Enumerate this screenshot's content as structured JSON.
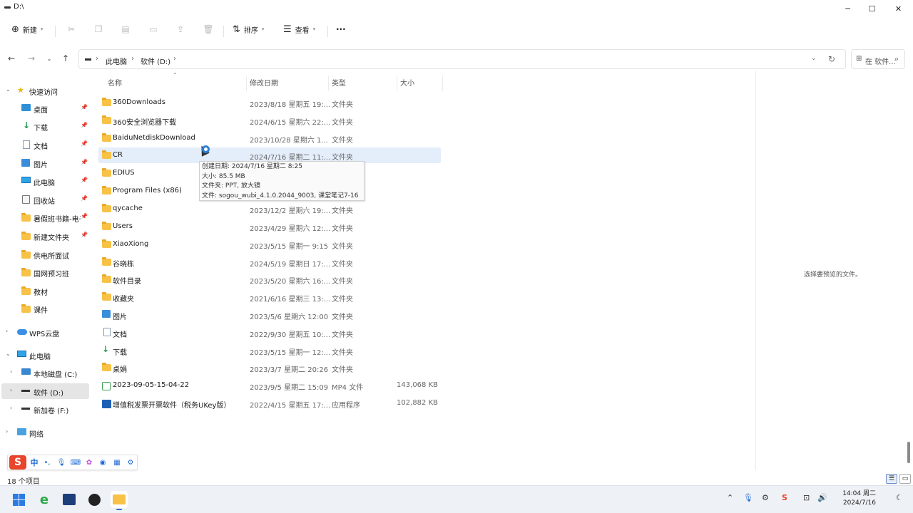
{
  "window": {
    "title": "D:\\",
    "controls": {
      "minimize": "─",
      "maximize": "☐",
      "close": "✕"
    }
  },
  "commandbar": {
    "new_label": "新建",
    "sort_label": "排序",
    "view_label": "查看",
    "more_label": "···"
  },
  "address": {
    "crumbs": [
      "此电脑",
      "软件 (D:)"
    ],
    "search_placeholder": "在 软件..."
  },
  "sidebar": {
    "items": [
      {
        "label": "快速访问"
      },
      {
        "label": "桌面"
      },
      {
        "label": "下载"
      },
      {
        "label": "文档"
      },
      {
        "label": "图片"
      },
      {
        "label": "此电脑"
      },
      {
        "label": "回收站"
      },
      {
        "label": "暑假班书籍-电子"
      },
      {
        "label": "新建文件夹"
      },
      {
        "label": "供电所面试"
      },
      {
        "label": "国网预习班"
      },
      {
        "label": "教材"
      },
      {
        "label": "课件"
      },
      {
        "label": "WPS云盘"
      },
      {
        "label": "此电脑"
      },
      {
        "label": "本地磁盘 (C:)"
      },
      {
        "label": "软件 (D:)"
      },
      {
        "label": "新加卷 (F:)"
      },
      {
        "label": "网络"
      }
    ]
  },
  "columns": {
    "name": "名称",
    "date": "修改日期",
    "type": "类型",
    "size": "大小"
  },
  "files": [
    {
      "name": "360Downloads",
      "date": "2023/8/18 星期五 19:...",
      "type": "文件夹",
      "size": ""
    },
    {
      "name": "360安全浏览器下载",
      "date": "2024/6/15 星期六 22:...",
      "type": "文件夹",
      "size": ""
    },
    {
      "name": "BaiduNetdiskDownload",
      "date": "2023/10/28 星期六 1...",
      "type": "文件夹",
      "size": ""
    },
    {
      "name": "CR",
      "date": "2024/7/16 星期二 11:...",
      "type": "文件夹",
      "size": ""
    },
    {
      "name": "EDIUS",
      "date": "",
      "type": "",
      "size": ""
    },
    {
      "name": "Program Files (x86)",
      "date": "",
      "type": "",
      "size": ""
    },
    {
      "name": "qycache",
      "date": "2023/12/2 星期六 19:...",
      "type": "文件夹",
      "size": ""
    },
    {
      "name": "Users",
      "date": "2023/4/29 星期六 12:...",
      "type": "文件夹",
      "size": ""
    },
    {
      "name": "XiaoXiong",
      "date": "2023/5/15 星期一 9:15",
      "type": "文件夹",
      "size": ""
    },
    {
      "name": "谷晓栋",
      "date": "2024/5/19 星期日 17:...",
      "type": "文件夹",
      "size": ""
    },
    {
      "name": "软件目录",
      "date": "2023/5/20 星期六 16:...",
      "type": "文件夹",
      "size": ""
    },
    {
      "name": "收藏夹",
      "date": "2021/6/16 星期三 13:...",
      "type": "文件夹",
      "size": ""
    },
    {
      "name": "图片",
      "date": "2023/5/6 星期六 12:00",
      "type": "文件夹",
      "size": ""
    },
    {
      "name": "文档",
      "date": "2022/9/30 星期五 10:...",
      "type": "文件夹",
      "size": ""
    },
    {
      "name": "下载",
      "date": "2023/5/15 星期一 12:...",
      "type": "文件夹",
      "size": ""
    },
    {
      "name": "桌娟",
      "date": "2023/3/7 星期二 20:26",
      "type": "文件夹",
      "size": ""
    },
    {
      "name": "2023-09-05-15-04-22",
      "date": "2023/9/5 星期二 15:09",
      "type": "MP4 文件",
      "size": "143,068 KB"
    },
    {
      "name": "增值税发票开票软件（税务UKey版）",
      "date": "2022/4/15 星期五 17:...",
      "type": "应用程序",
      "size": "102,882 KB"
    }
  ],
  "tooltip": {
    "line1": "创建日期: 2024/7/16 星期二 8:25",
    "line2": "大小: 85.5 MB",
    "line3": "文件夹: PPT, 放大镜",
    "line4": "文件: sogou_wubi_4.1.0.2044_9003, 课堂笔记7-16"
  },
  "preview_text": "选择要预览的文件。",
  "ime": {
    "logo": "S",
    "mode": "中",
    "punct": "•,"
  },
  "status_text": "18 个项目",
  "taskbar": {
    "time": "14:04 周二",
    "date": "2024/7/16"
  },
  "colors": {
    "accent": "#2f6fd0",
    "selection": "#e4eefb",
    "folder": "#f8c246"
  }
}
